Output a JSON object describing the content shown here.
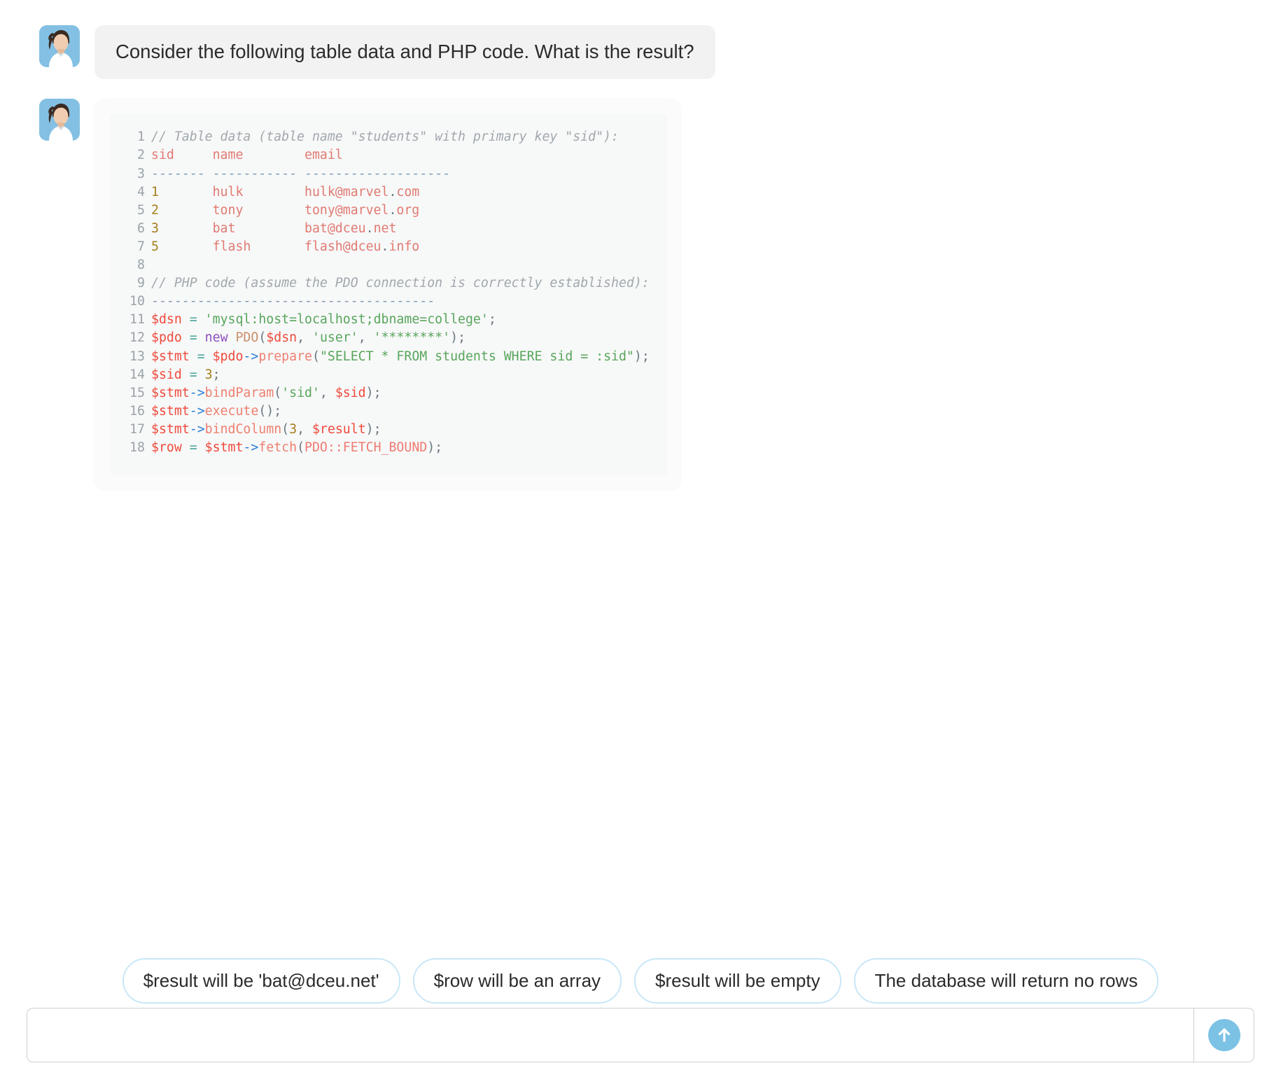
{
  "messages": [
    {
      "type": "text",
      "avatar": "user-avatar",
      "text": "Consider the following table data and PHP code. What is the result?"
    },
    {
      "type": "code",
      "avatar": "user-avatar"
    }
  ],
  "code_block": {
    "language": "php",
    "lines": [
      {
        "n": "1",
        "tokens": [
          {
            "c": "t-comment",
            "t": "// Table data (table name \"students\" with primary key \"sid\"):"
          }
        ]
      },
      {
        "n": "2",
        "tokens": [
          {
            "c": "t-plain",
            "t": "sid     name        email"
          }
        ]
      },
      {
        "n": "3",
        "tokens": [
          {
            "c": "t-rule",
            "t": "------- ----------- -------------------"
          }
        ]
      },
      {
        "n": "4",
        "tokens": [
          {
            "c": "t-num",
            "t": "1"
          },
          {
            "c": "t-plain",
            "t": "       hulk        hulk@marvel"
          },
          {
            "c": "t-punc",
            "t": "."
          },
          {
            "c": "t-plain",
            "t": "com"
          }
        ]
      },
      {
        "n": "5",
        "tokens": [
          {
            "c": "t-num",
            "t": "2"
          },
          {
            "c": "t-plain",
            "t": "       tony        tony@marvel"
          },
          {
            "c": "t-punc",
            "t": "."
          },
          {
            "c": "t-plain",
            "t": "org"
          }
        ]
      },
      {
        "n": "6",
        "tokens": [
          {
            "c": "t-num",
            "t": "3"
          },
          {
            "c": "t-plain",
            "t": "       bat         bat@dceu"
          },
          {
            "c": "t-punc",
            "t": "."
          },
          {
            "c": "t-plain",
            "t": "net"
          }
        ]
      },
      {
        "n": "7",
        "tokens": [
          {
            "c": "t-num",
            "t": "5"
          },
          {
            "c": "t-plain",
            "t": "       flash       flash@dceu"
          },
          {
            "c": "t-punc",
            "t": "."
          },
          {
            "c": "t-plain",
            "t": "info"
          }
        ]
      },
      {
        "n": "8",
        "tokens": [
          {
            "c": "t-plain",
            "t": ""
          }
        ]
      },
      {
        "n": "9",
        "tokens": [
          {
            "c": "t-comment",
            "t": "// PHP code (assume the PDO connection is correctly established):"
          }
        ]
      },
      {
        "n": "10",
        "tokens": [
          {
            "c": "t-rule",
            "t": "-------------------------------------"
          }
        ]
      },
      {
        "n": "11",
        "tokens": [
          {
            "c": "t-var",
            "t": "$dsn"
          },
          {
            "c": "t-plain2",
            "t": " "
          },
          {
            "c": "t-op",
            "t": "="
          },
          {
            "c": "t-plain2",
            "t": " "
          },
          {
            "c": "t-str",
            "t": "'mysql:host=localhost;dbname=college'"
          },
          {
            "c": "t-punc",
            "t": ";"
          }
        ]
      },
      {
        "n": "12",
        "tokens": [
          {
            "c": "t-var",
            "t": "$pdo"
          },
          {
            "c": "t-plain2",
            "t": " "
          },
          {
            "c": "t-op",
            "t": "="
          },
          {
            "c": "t-plain2",
            "t": " "
          },
          {
            "c": "t-kw",
            "t": "new"
          },
          {
            "c": "t-plain2",
            "t": " "
          },
          {
            "c": "t-class",
            "t": "PDO"
          },
          {
            "c": "t-punc",
            "t": "("
          },
          {
            "c": "t-var",
            "t": "$dsn"
          },
          {
            "c": "t-punc",
            "t": ", "
          },
          {
            "c": "t-str",
            "t": "'user'"
          },
          {
            "c": "t-punc",
            "t": ", "
          },
          {
            "c": "t-str",
            "t": "'********'"
          },
          {
            "c": "t-punc",
            "t": ");"
          }
        ]
      },
      {
        "n": "13",
        "tokens": [
          {
            "c": "t-var",
            "t": "$stmt"
          },
          {
            "c": "t-plain2",
            "t": " "
          },
          {
            "c": "t-op",
            "t": "="
          },
          {
            "c": "t-plain2",
            "t": " "
          },
          {
            "c": "t-var",
            "t": "$pdo"
          },
          {
            "c": "t-arrow",
            "t": "->"
          },
          {
            "c": "t-fn",
            "t": "prepare"
          },
          {
            "c": "t-punc",
            "t": "("
          },
          {
            "c": "t-str",
            "t": "\"SELECT * FROM students WHERE sid = :sid\""
          },
          {
            "c": "t-punc",
            "t": ");"
          }
        ]
      },
      {
        "n": "14",
        "tokens": [
          {
            "c": "t-var",
            "t": "$sid"
          },
          {
            "c": "t-plain2",
            "t": " "
          },
          {
            "c": "t-op",
            "t": "="
          },
          {
            "c": "t-plain2",
            "t": " "
          },
          {
            "c": "t-num",
            "t": "3"
          },
          {
            "c": "t-punc",
            "t": ";"
          }
        ]
      },
      {
        "n": "15",
        "tokens": [
          {
            "c": "t-var",
            "t": "$stmt"
          },
          {
            "c": "t-arrow",
            "t": "->"
          },
          {
            "c": "t-fn",
            "t": "bindParam"
          },
          {
            "c": "t-punc",
            "t": "("
          },
          {
            "c": "t-str",
            "t": "'sid'"
          },
          {
            "c": "t-punc",
            "t": ", "
          },
          {
            "c": "t-var",
            "t": "$sid"
          },
          {
            "c": "t-punc",
            "t": ");"
          }
        ]
      },
      {
        "n": "16",
        "tokens": [
          {
            "c": "t-var",
            "t": "$stmt"
          },
          {
            "c": "t-arrow",
            "t": "->"
          },
          {
            "c": "t-fn",
            "t": "execute"
          },
          {
            "c": "t-punc",
            "t": "();"
          }
        ]
      },
      {
        "n": "17",
        "tokens": [
          {
            "c": "t-var",
            "t": "$stmt"
          },
          {
            "c": "t-arrow",
            "t": "->"
          },
          {
            "c": "t-fn",
            "t": "bindColumn"
          },
          {
            "c": "t-punc",
            "t": "("
          },
          {
            "c": "t-num",
            "t": "3"
          },
          {
            "c": "t-punc",
            "t": ", "
          },
          {
            "c": "t-var",
            "t": "$result"
          },
          {
            "c": "t-punc",
            "t": ");"
          }
        ]
      },
      {
        "n": "18",
        "tokens": [
          {
            "c": "t-var",
            "t": "$row"
          },
          {
            "c": "t-plain2",
            "t": " "
          },
          {
            "c": "t-op",
            "t": "="
          },
          {
            "c": "t-plain2",
            "t": " "
          },
          {
            "c": "t-var",
            "t": "$stmt"
          },
          {
            "c": "t-arrow",
            "t": "->"
          },
          {
            "c": "t-fn",
            "t": "fetch"
          },
          {
            "c": "t-punc",
            "t": "("
          },
          {
            "c": "t-const",
            "t": "PDO::FETCH_BOUND"
          },
          {
            "c": "t-punc",
            "t": ");"
          }
        ]
      }
    ]
  },
  "suggestions": [
    "$result will be 'bat@dceu.net'",
    "$row will be an array",
    "$result will be empty",
    "The database will return no rows"
  ],
  "composer": {
    "value": "",
    "placeholder": "",
    "send_icon": "arrow-up-circle-icon"
  },
  "colors": {
    "accent": "#7cc2e5",
    "chip_border": "#c9e7f7",
    "bubble_bg": "#f2f2f2",
    "code_bg": "#f7f8f8",
    "avatar_bg": "#83c0e3"
  }
}
